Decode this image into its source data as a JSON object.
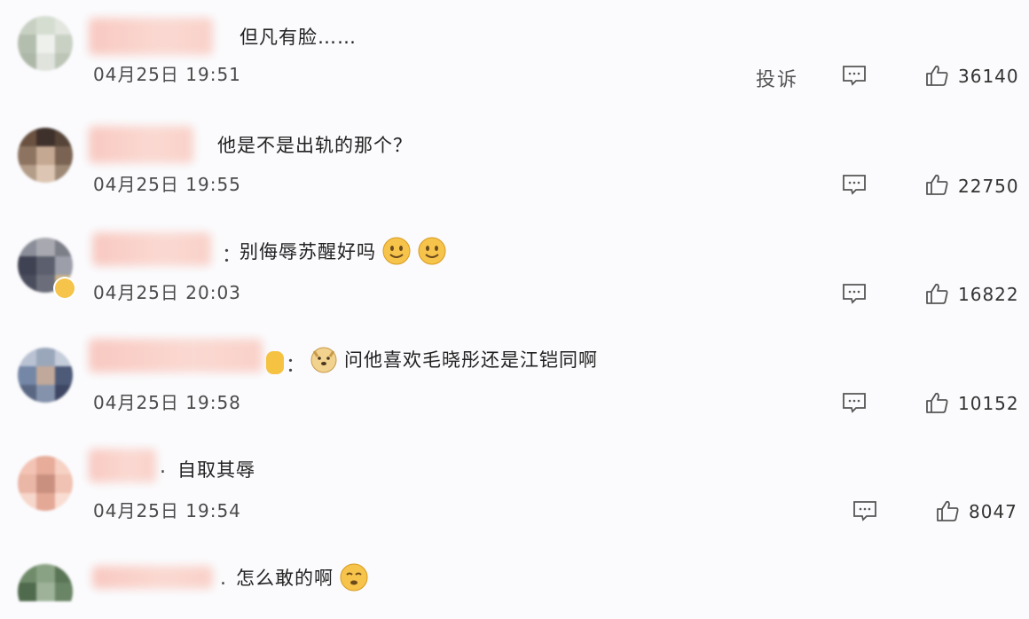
{
  "comments": [
    {
      "text": "但凡有脸……",
      "time": "04月25日 19:51",
      "likes": "36140",
      "report_label": "投诉"
    },
    {
      "text": "他是不是出轨的那个？",
      "time": "04月25日 19:55",
      "likes": "22750"
    },
    {
      "separator": "：",
      "text": "别侮辱苏醒好吗",
      "time": "04月25日 20:03",
      "likes": "16822"
    },
    {
      "separator": "：",
      "text": "问他喜欢毛晓彤还是江铠同啊",
      "time": "04月25日 19:58",
      "likes": "10152"
    },
    {
      "separator": ".",
      "text": "自取其辱",
      "time": "04月25日 19:54",
      "likes": "8047"
    },
    {
      "separator": ".",
      "text": "怎么敢的啊"
    }
  ],
  "icons": {
    "reply": "comment-bubble-icon",
    "like": "thumbs-up-icon",
    "emoji_smile": "smile-emoji-icon",
    "emoji_doge": "doge-emoji-icon",
    "emoji_blush": "blush-emoji-icon"
  },
  "colors": {
    "background": "#fbfbfd",
    "name_blur": "#f8c9c1",
    "emoji": "#f6c34b"
  }
}
